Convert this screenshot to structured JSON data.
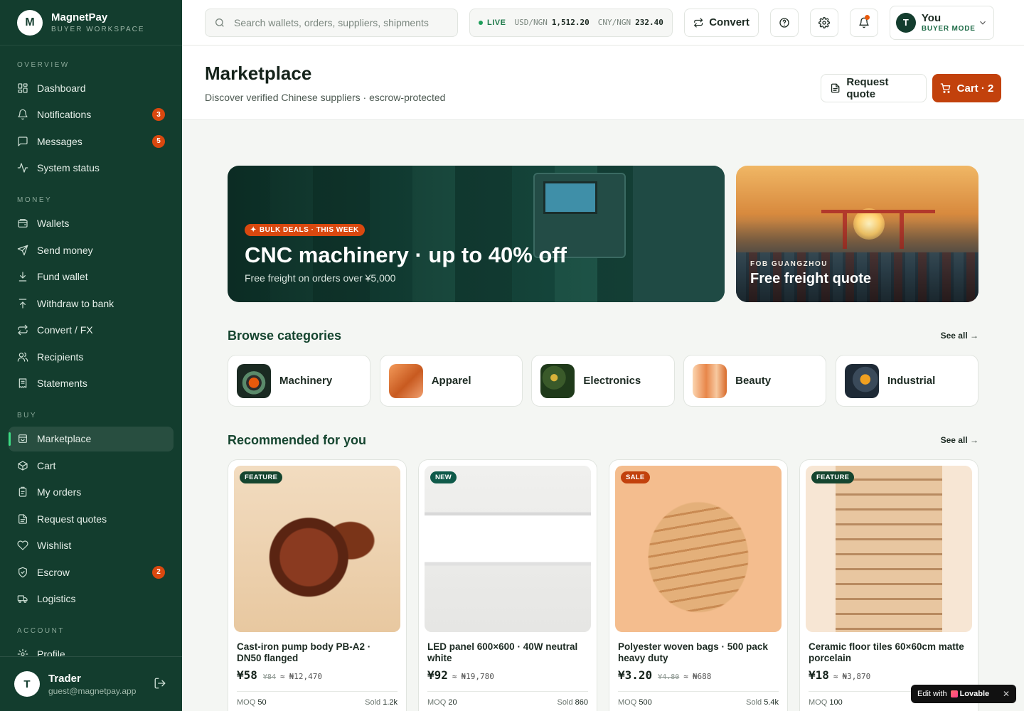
{
  "brand": {
    "logo_letter": "M",
    "name": "MagnetPay",
    "subtitle": "BUYER WORKSPACE"
  },
  "sidebar": {
    "sections": [
      {
        "heading": "OVERVIEW",
        "items": [
          {
            "label": "Dashboard",
            "icon": "dashboard-icon"
          },
          {
            "label": "Notifications",
            "icon": "bell-icon",
            "badge": "3"
          },
          {
            "label": "Messages",
            "icon": "message-icon",
            "badge": "5"
          },
          {
            "label": "System status",
            "icon": "activity-icon"
          }
        ]
      },
      {
        "heading": "MONEY",
        "items": [
          {
            "label": "Wallets",
            "icon": "wallet-icon"
          },
          {
            "label": "Send money",
            "icon": "send-icon"
          },
          {
            "label": "Fund wallet",
            "icon": "download-icon"
          },
          {
            "label": "Withdraw to bank",
            "icon": "upload-icon"
          },
          {
            "label": "Convert / FX",
            "icon": "swap-icon"
          },
          {
            "label": "Recipients",
            "icon": "users-icon"
          },
          {
            "label": "Statements",
            "icon": "receipt-icon"
          }
        ]
      },
      {
        "heading": "BUY",
        "items": [
          {
            "label": "Marketplace",
            "icon": "store-icon",
            "active": true
          },
          {
            "label": "Cart",
            "icon": "package-icon"
          },
          {
            "label": "My orders",
            "icon": "clipboard-icon"
          },
          {
            "label": "Request quotes",
            "icon": "document-icon"
          },
          {
            "label": "Wishlist",
            "icon": "heart-icon"
          },
          {
            "label": "Escrow",
            "icon": "shield-icon",
            "badge": "2"
          },
          {
            "label": "Logistics",
            "icon": "truck-icon"
          }
        ]
      },
      {
        "heading": "ACCOUNT",
        "items": [
          {
            "label": "Profile",
            "icon": "settings-icon"
          }
        ]
      }
    ],
    "user": {
      "initial": "T",
      "name": "Trader",
      "email": "guest@magnetpay.app"
    }
  },
  "topbar": {
    "search_placeholder": "Search wallets, orders, suppliers, shipments",
    "live_label": "LIVE",
    "rates": [
      {
        "pair": "USD/NGN",
        "value": "1,512.20"
      },
      {
        "pair": "CNY/NGN",
        "value": "232.40"
      }
    ],
    "convert_label": "Convert",
    "user": {
      "initial": "T",
      "name": "You",
      "mode": "BUYER MODE"
    }
  },
  "page": {
    "title": "Marketplace",
    "subtitle": "Discover verified Chinese suppliers · escrow-protected",
    "request_quote_label": "Request quote",
    "cart_label": "Cart · 2"
  },
  "banners": {
    "main": {
      "tag": "BULK DEALS · THIS WEEK",
      "title": "CNC machinery · up to 40% off",
      "subtitle": "Free freight on orders over ¥5,000"
    },
    "side": {
      "kicker": "FOB GUANGZHOU",
      "title": "Free freight quote"
    }
  },
  "categories": {
    "title": "Browse categories",
    "see_all": "See all →",
    "items": [
      {
        "label": "Machinery",
        "color": "#c2410c"
      },
      {
        "label": "Apparel",
        "color": "#e07a3a"
      },
      {
        "label": "Electronics",
        "color": "#8a7a2a"
      },
      {
        "label": "Beauty",
        "color": "#f0b07a"
      },
      {
        "label": "Industrial",
        "color": "#3a4a5a"
      }
    ]
  },
  "recommended": {
    "title": "Recommended for you",
    "see_all": "See all →",
    "items": [
      {
        "badge": "FEATURE",
        "badge_color": "#15452f",
        "name": "Cast-iron pump body PB-A2 · DN50 flanged",
        "price": "¥58",
        "old_price": "¥84",
        "approx": "≈",
        "ngn": "₦12,470",
        "moq_label": "MOQ",
        "moq": "50",
        "sold_label": "Sold",
        "sold": "1.2k"
      },
      {
        "badge": "NEW",
        "badge_color": "#0f5a4a",
        "name": "LED panel 600×600 · 40W neutral white",
        "price": "¥92",
        "old_price": "",
        "approx": "≈",
        "ngn": "₦19,780",
        "moq_label": "MOQ",
        "moq": "20",
        "sold_label": "Sold",
        "sold": "860"
      },
      {
        "badge": "SALE",
        "badge_color": "#c2410c",
        "name": "Polyester woven bags · 500 pack heavy duty",
        "price": "¥3.20",
        "old_price": "¥4.80",
        "approx": "≈",
        "ngn": "₦688",
        "moq_label": "MOQ",
        "moq": "500",
        "sold_label": "Sold",
        "sold": "5.4k"
      },
      {
        "badge": "FEATURE",
        "badge_color": "#15452f",
        "name": "Ceramic floor tiles 60×60cm matte porcelain",
        "price": "¥18",
        "old_price": "",
        "approx": "≈",
        "ngn": "₦3,870",
        "moq_label": "MOQ",
        "moq": "100",
        "sold_label": "Sold",
        "sold": ""
      }
    ]
  },
  "lovable": {
    "prefix": "Edit with",
    "brand": "Lovable",
    "close": "✕"
  }
}
